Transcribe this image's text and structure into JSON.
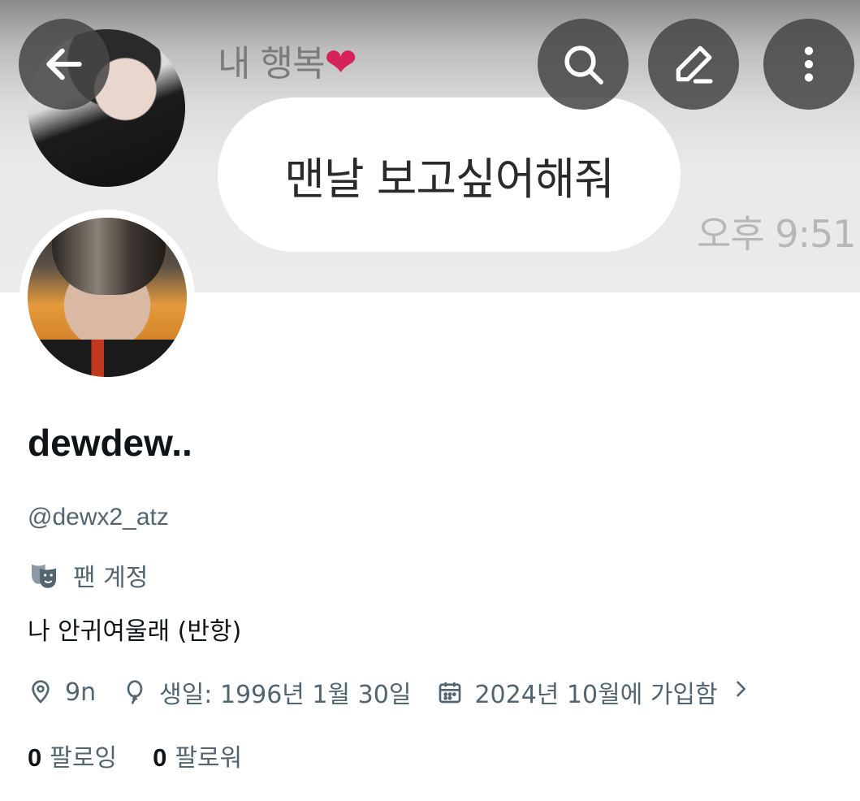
{
  "banner": {
    "chat_sender": "내 행복",
    "chat_sender_emoji": "❤",
    "chat_message": "맨날 보고싶어해줘",
    "chat_time": "오후 9:51"
  },
  "top_bar": {
    "back_icon": "arrow-left-icon",
    "search_icon": "search-icon",
    "edit_icon": "pencil-icon",
    "more_icon": "more-vertical-icon"
  },
  "profile": {
    "display_name": "dewdew..",
    "handle": "@dewx2_atz",
    "account_type_icon": "theater-mask-icon",
    "account_type": "팬 계정",
    "bio": "나 안귀여울래 (반항)",
    "location": "9n",
    "birthday": "생일: 1996년 1월 30일",
    "joined": "2024년 10월에 가입함",
    "following_count": "0",
    "following_label": "팔로잉",
    "followers_count": "0",
    "followers_label": "팔로워"
  },
  "colors": {
    "text_primary": "#0f1419",
    "text_secondary": "#536471",
    "button_overlay": "#464646",
    "heart": "#d6245a"
  }
}
